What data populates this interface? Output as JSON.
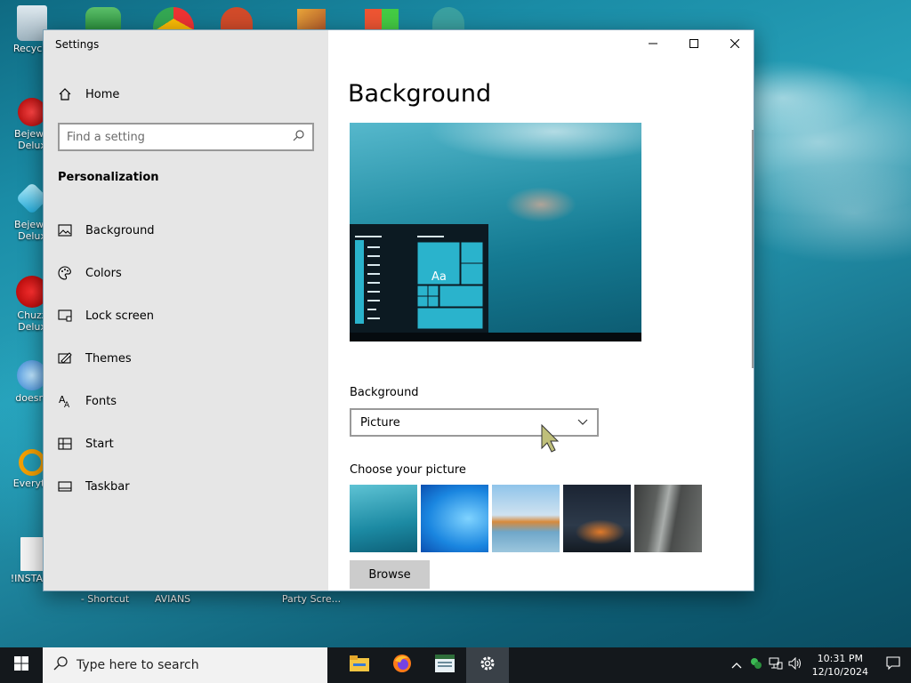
{
  "desktop": {
    "icons": [
      {
        "label": "Recycle",
        "icon": "recycle-bin-icon"
      },
      {
        "label": "Bejewe Delux",
        "icon": "bejeweled-icon"
      },
      {
        "label": "Bejewe Delux",
        "icon": "bejeweled-gem-icon"
      },
      {
        "label": "Chuzz Delux",
        "icon": "chuzzle-icon"
      },
      {
        "label": "doesnt",
        "icon": "bird-icon"
      },
      {
        "label": "Everyth",
        "icon": "everything-search-icon"
      },
      {
        "label": "!INSTALL",
        "icon": "document-icon"
      },
      {
        "label": "- Shortcut",
        "icon": "shortcut-icon"
      },
      {
        "label": "AVIANS",
        "icon": "game-icon"
      },
      {
        "label": "Party Scre...",
        "icon": "game-icon"
      }
    ]
  },
  "window": {
    "title": "Settings",
    "controls": {
      "minimize": "minimize-icon",
      "maximize": "maximize-icon",
      "close": "close-icon"
    }
  },
  "sidebar": {
    "home_label": "Home",
    "search_placeholder": "Find a setting",
    "section_title": "Personalization",
    "items": [
      {
        "label": "Background",
        "icon": "image-icon"
      },
      {
        "label": "Colors",
        "icon": "palette-icon"
      },
      {
        "label": "Lock screen",
        "icon": "lock-screen-icon"
      },
      {
        "label": "Themes",
        "icon": "themes-icon"
      },
      {
        "label": "Fonts",
        "icon": "fonts-icon"
      },
      {
        "label": "Start",
        "icon": "start-icon"
      },
      {
        "label": "Taskbar",
        "icon": "taskbar-icon"
      }
    ]
  },
  "main": {
    "page_title": "Background",
    "preview_sample_text": "Aa",
    "background_label": "Background",
    "background_value": "Picture",
    "choose_picture_label": "Choose your picture",
    "browse_label": "Browse"
  },
  "taskbar": {
    "search_placeholder": "Type here to search",
    "apps": [
      "file-explorer-icon",
      "firefox-icon",
      "app-window-icon",
      "settings-gear-icon"
    ],
    "clock_time": "10:31 PM",
    "clock_date": "12/10/2024"
  },
  "colors": {
    "accent": "#2ab3cc",
    "sidebar_bg": "#e6e6e6",
    "taskbar_bg": "#14181c"
  }
}
